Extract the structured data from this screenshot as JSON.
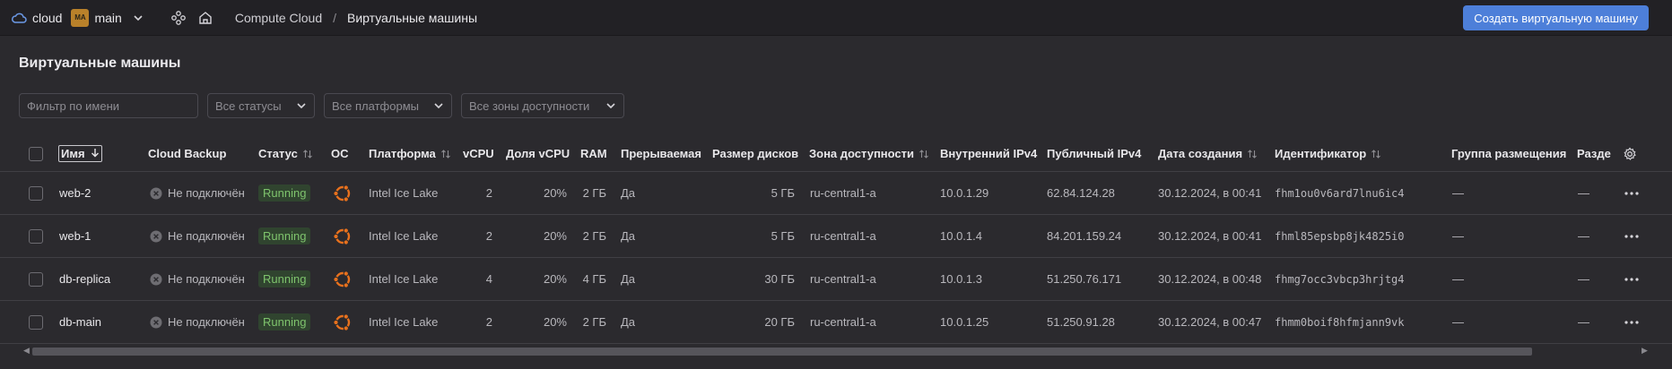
{
  "topbar": {
    "cloud_label": "cloud",
    "folder_avatar": "MA",
    "folder_label": "main",
    "breadcrumb_root": "Compute Cloud",
    "breadcrumb_sep": "/",
    "breadcrumb_current": "Виртуальные машины",
    "create_button": "Создать виртуальную машину"
  },
  "page": {
    "title": "Виртуальные машины"
  },
  "filters": {
    "name_placeholder": "Фильтр по имени",
    "status": "Все статусы",
    "platform": "Все платформы",
    "zone": "Все зоны доступности"
  },
  "columns": {
    "name": "Имя",
    "backup": "Cloud Backup",
    "status": "Статус",
    "os": "ОС",
    "platform": "Платформа",
    "vcpu": "vCPU",
    "vcpu_share": "Доля vCPU",
    "ram": "RAM",
    "preemptible": "Прерываемая",
    "disk_size": "Размер дисков",
    "zone": "Зона доступности",
    "ipv4_internal": "Внутренний IPv4",
    "ipv4_public": "Публичный IPv4",
    "created": "Дата создания",
    "id": "Идентификатор",
    "placement": "Группа размещения",
    "section": "Разде"
  },
  "rows": [
    {
      "name": "web-2",
      "backup": "Не подключён",
      "status": "Running",
      "platform": "Intel Ice Lake",
      "vcpu": "2",
      "share": "20%",
      "ram": "2 ГБ",
      "preemptible": "Да",
      "disk": "5 ГБ",
      "zone": "ru-central1-a",
      "ip_int": "10.0.1.29",
      "ip_pub": "62.84.124.28",
      "created": "30.12.2024, в 00:41",
      "id": "fhm1ou0v6ard7lnu6ic4",
      "placement": "—",
      "section": "—"
    },
    {
      "name": "web-1",
      "backup": "Не подключён",
      "status": "Running",
      "platform": "Intel Ice Lake",
      "vcpu": "2",
      "share": "20%",
      "ram": "2 ГБ",
      "preemptible": "Да",
      "disk": "5 ГБ",
      "zone": "ru-central1-a",
      "ip_int": "10.0.1.4",
      "ip_pub": "84.201.159.24",
      "created": "30.12.2024, в 00:41",
      "id": "fhml85epsbp8jk4825i0",
      "placement": "—",
      "section": "—"
    },
    {
      "name": "db-replica",
      "backup": "Не подключён",
      "status": "Running",
      "platform": "Intel Ice Lake",
      "vcpu": "4",
      "share": "20%",
      "ram": "4 ГБ",
      "preemptible": "Да",
      "disk": "30 ГБ",
      "zone": "ru-central1-a",
      "ip_int": "10.0.1.3",
      "ip_pub": "51.250.76.171",
      "created": "30.12.2024, в 00:48",
      "id": "fhmg7occ3vbcp3hrjtg4",
      "placement": "—",
      "section": "—"
    },
    {
      "name": "db-main",
      "backup": "Не подключён",
      "status": "Running",
      "platform": "Intel Ice Lake",
      "vcpu": "2",
      "share": "20%",
      "ram": "2 ГБ",
      "preemptible": "Да",
      "disk": "20 ГБ",
      "zone": "ru-central1-a",
      "ip_int": "10.0.1.25",
      "ip_pub": "51.250.91.28",
      "created": "30.12.2024, в 00:47",
      "id": "fhmm0boif8hfmjann9vk",
      "placement": "—",
      "section": "—"
    }
  ],
  "icons": {
    "os": "ubuntu-icon",
    "row_menu": "more-dots-icon",
    "settings": "gear-icon"
  },
  "colors": {
    "accent": "#4d7fd9",
    "status_running_bg": "#30442f",
    "status_running_text": "#7fc46d",
    "ubuntu": "#e8711d"
  }
}
